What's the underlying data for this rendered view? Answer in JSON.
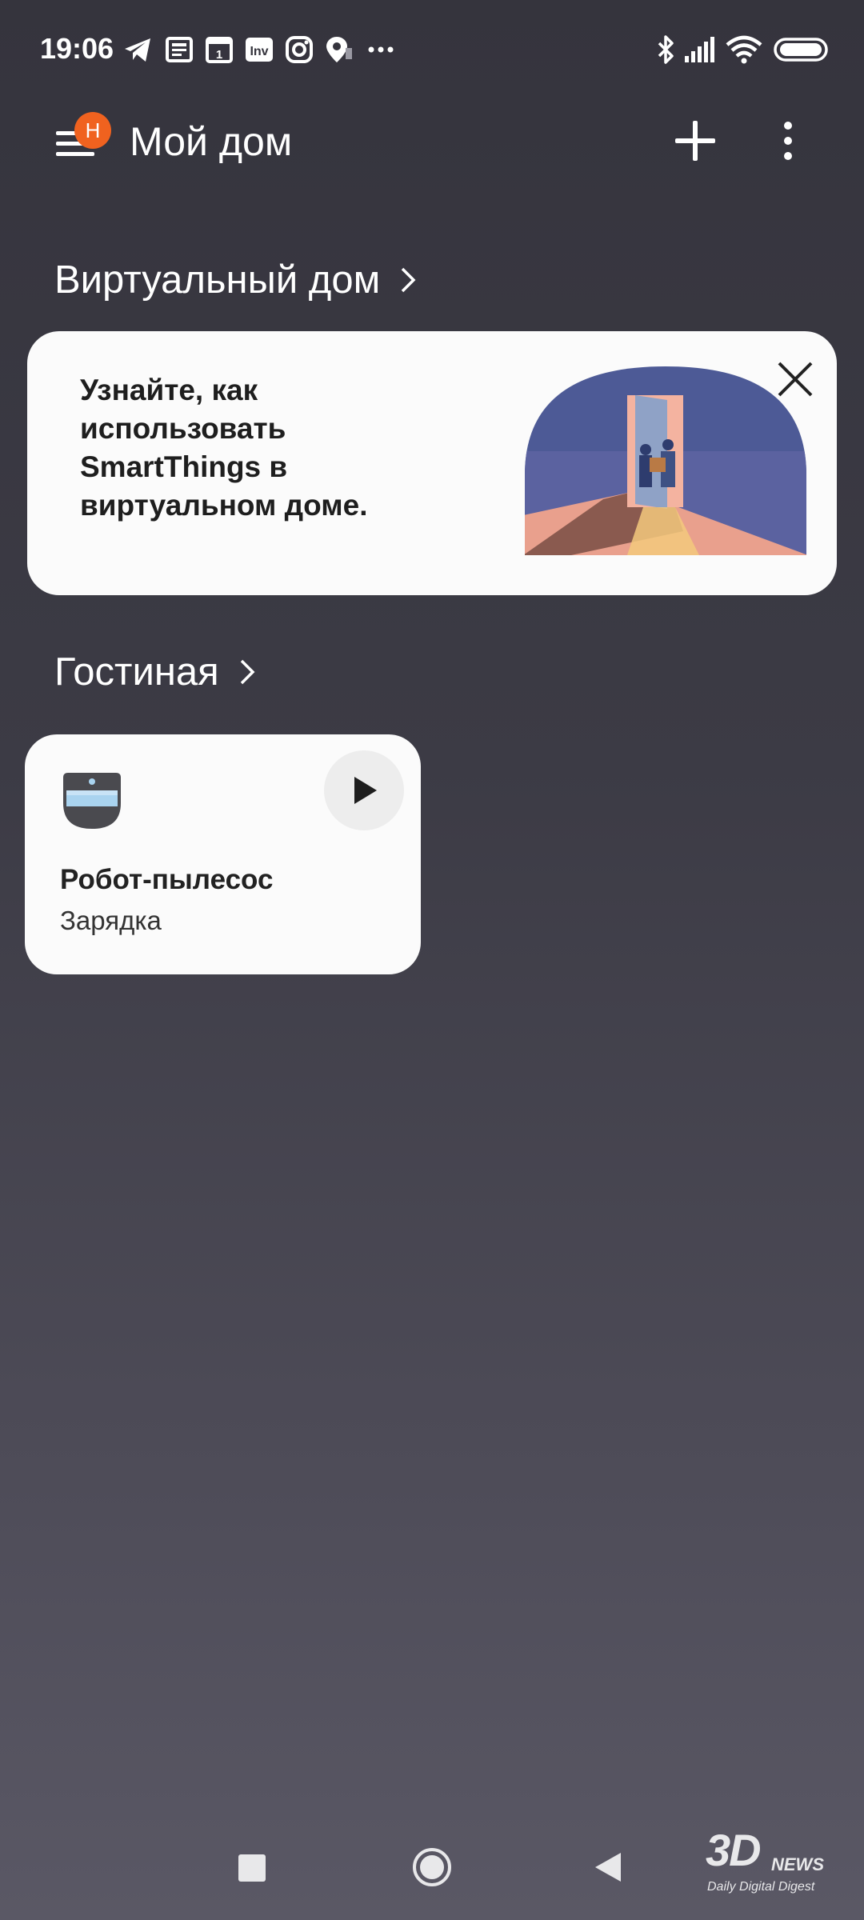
{
  "status_bar": {
    "time": "19:06",
    "notification_icons": [
      "telegram-icon",
      "news-icon",
      "calendar-icon",
      "inv-app-icon",
      "instagram-icon",
      "location-icon",
      "more-dots-icon"
    ],
    "calendar_day": "1",
    "inv_label": "Inv",
    "system_icons": [
      "bluetooth-icon",
      "signal-icon",
      "wifi-icon",
      "battery-icon"
    ]
  },
  "header": {
    "title": "Мой дом",
    "menu_badge": "Н",
    "icons": [
      "menu-icon",
      "plus-icon",
      "more-vertical-icon"
    ]
  },
  "sections": {
    "virtual_home": {
      "title": "Виртуальный дом"
    },
    "living_room": {
      "title": "Гостиная"
    }
  },
  "promo": {
    "text": "Узнайте, как использовать SmartThings в виртуальном доме."
  },
  "device": {
    "name": "Робот-пылесос",
    "status": "Зарядка",
    "icon": "robot-vacuum-icon"
  },
  "nav": {
    "icons": [
      "recents-square-icon",
      "home-circle-icon",
      "back-triangle-icon"
    ]
  },
  "watermark": {
    "brand": "3D",
    "brand_news": "NEWS",
    "tagline": "Daily Digital Digest"
  },
  "colors": {
    "accent_badge": "#f0621f",
    "card_bg": "#fbfbfb",
    "background_top": "#35343d",
    "background_bottom": "#5a5865"
  }
}
